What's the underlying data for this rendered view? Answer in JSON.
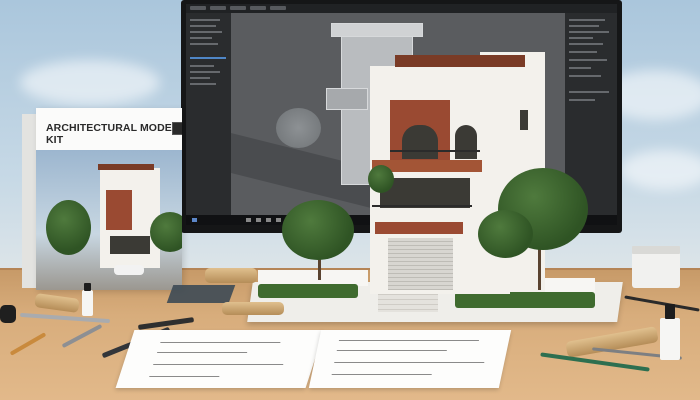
{
  "scene": {
    "description_colors": {
      "sky": "#b6cde0",
      "desk": "#d8ad7c",
      "brick": "#9a4a32",
      "facade": "#f3f1ec"
    }
  },
  "product_box": {
    "small_text": "",
    "title": "ARCHITECTURAL MODEL KIT"
  },
  "monitor": {
    "app": "3d-modeling-viewport"
  }
}
